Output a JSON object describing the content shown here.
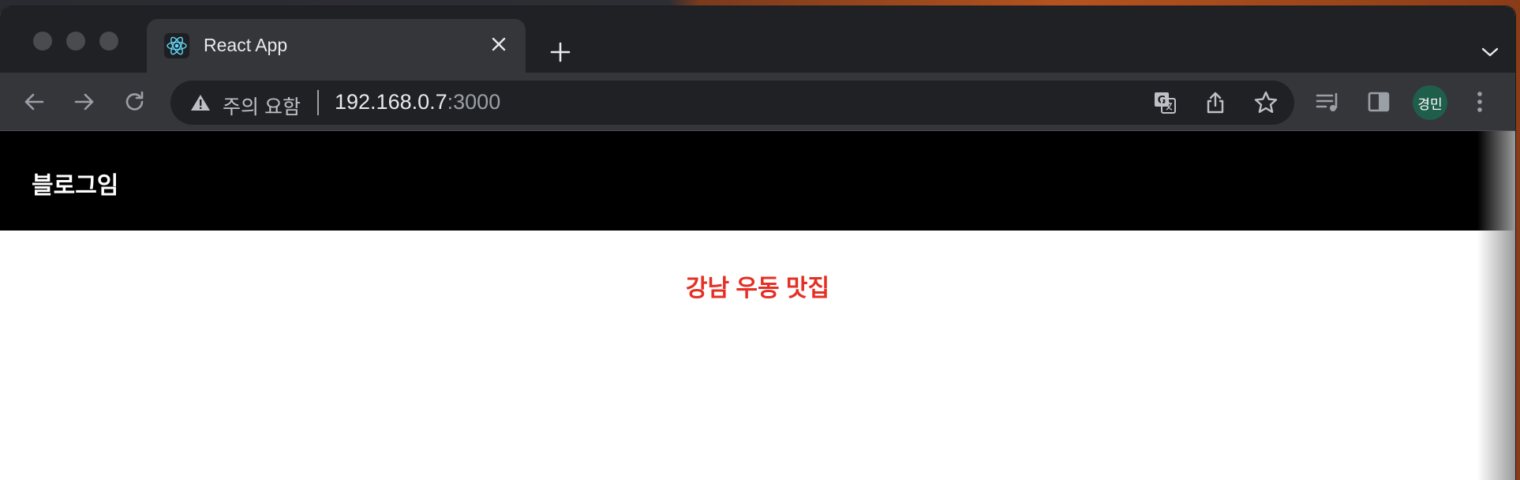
{
  "browser": {
    "tab": {
      "title": "React App",
      "icon": "react-icon"
    },
    "address": {
      "security_label": "주의 요함",
      "host": "192.168.0.7",
      "port": ":3000"
    },
    "profile_initials": "경민"
  },
  "app": {
    "brand": "블로그임",
    "post_title": "강남 우동 맛집",
    "title_color": "#e52f24"
  }
}
